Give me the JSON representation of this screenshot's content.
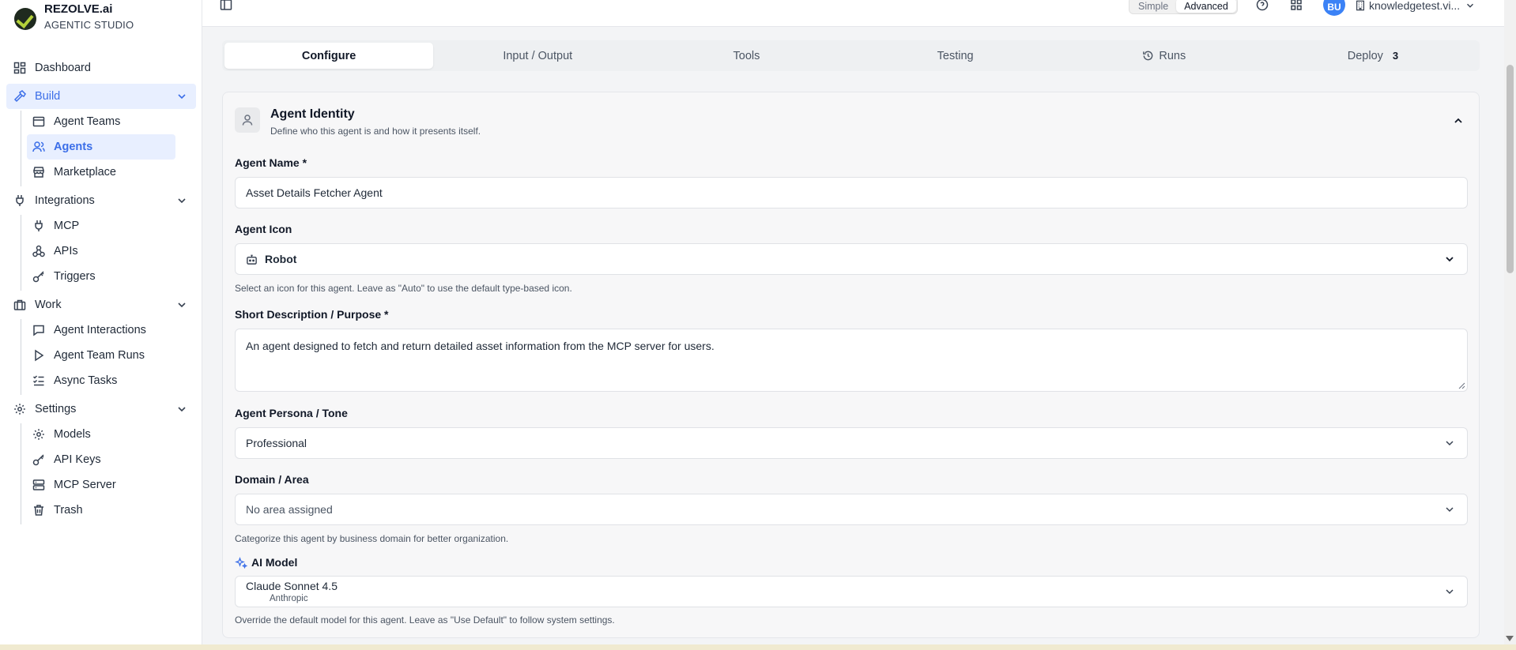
{
  "brand": {
    "name": "REZOLVE.ai",
    "subtitle": "AGENTIC STUDIO"
  },
  "sidebar": {
    "dashboard": "Dashboard",
    "build": {
      "label": "Build",
      "items": [
        "Agent Teams",
        "Agents",
        "Marketplace"
      ]
    },
    "integrations": {
      "label": "Integrations",
      "items": [
        "MCP",
        "APIs",
        "Triggers"
      ]
    },
    "work": {
      "label": "Work",
      "items": [
        "Agent Interactions",
        "Agent Team Runs",
        "Async Tasks"
      ]
    },
    "settings": {
      "label": "Settings",
      "items": [
        "Models",
        "API Keys",
        "MCP Server",
        "Trash"
      ]
    }
  },
  "topbar": {
    "mode_simple": "Simple",
    "mode_advanced": "Advanced",
    "active_mode": "Advanced",
    "avatar_initials": "BU",
    "workspace": "knowledgetest.vi..."
  },
  "tabs": [
    {
      "label": "Configure",
      "active": true
    },
    {
      "label": "Input / Output"
    },
    {
      "label": "Tools"
    },
    {
      "label": "Testing"
    },
    {
      "label": "Runs",
      "icon": "history-icon"
    },
    {
      "label": "Deploy",
      "badge": "3"
    }
  ],
  "card": {
    "title": "Agent Identity",
    "subtitle": "Define who this agent is and how it presents itself."
  },
  "form": {
    "name_label": "Agent Name *",
    "name_value": "Asset Details Fetcher Agent",
    "icon_label": "Agent Icon",
    "icon_value": "Robot",
    "icon_help": "Select an icon for this agent. Leave as \"Auto\" to use the default type-based icon.",
    "desc_label": "Short Description / Purpose *",
    "desc_value": "An agent designed to fetch and return detailed asset information from the MCP server for users.",
    "persona_label": "Agent Persona / Tone",
    "persona_value": "Professional",
    "domain_label": "Domain / Area",
    "domain_value": "No area assigned",
    "domain_help": "Categorize this agent by business domain for better organization.",
    "model_label": "AI Model",
    "model_value": "Claude Sonnet 4.5",
    "model_provider": "Anthropic",
    "model_help": "Override the default model for this agent. Leave as \"Use Default\" to follow system settings."
  },
  "colors": {
    "accent": "#3b6ee8",
    "active_bg": "#e8efff",
    "avatar": "#3b82f6"
  }
}
